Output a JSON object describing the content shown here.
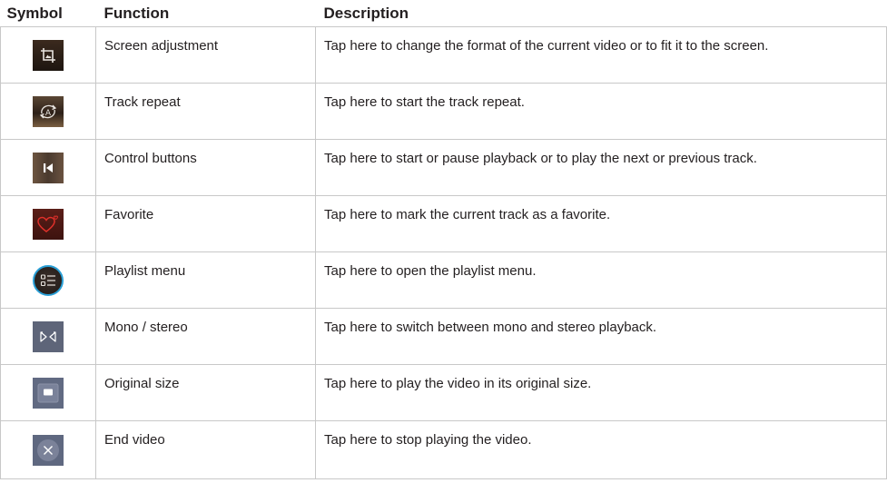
{
  "headers": {
    "symbol": "Symbol",
    "function": "Function",
    "description": "Description"
  },
  "rows": [
    {
      "icon": "screen-adjustment-icon",
      "function": "Screen adjustment",
      "description": "Tap here to change the format of the current video or to fit it to the screen."
    },
    {
      "icon": "track-repeat-icon",
      "function": "Track repeat",
      "description": "Tap here to start the track repeat."
    },
    {
      "icon": "previous-track-icon",
      "function": "Control buttons",
      "description": "Tap here to start or pause playback or to play the next or previous track."
    },
    {
      "icon": "favorite-heart-icon",
      "function": "Favorite",
      "description": "Tap here to mark the current track as a favorite."
    },
    {
      "icon": "playlist-menu-icon",
      "function": "Playlist menu",
      "description": "Tap here to open the playlist menu."
    },
    {
      "icon": "mono-stereo-icon",
      "function": "Mono / stereo",
      "description": "Tap here to switch between mono and stereo playback."
    },
    {
      "icon": "original-size-icon",
      "function": "Original size",
      "description": "Tap here to play the video in its original size."
    },
    {
      "icon": "end-video-icon",
      "function": "End video",
      "description": "Tap here to stop playing the video."
    }
  ],
  "colors": {
    "border": "#c8c8c8",
    "text": "#231f20",
    "accent_blue": "#2a9fd6",
    "heart_red": "#e0302a"
  }
}
